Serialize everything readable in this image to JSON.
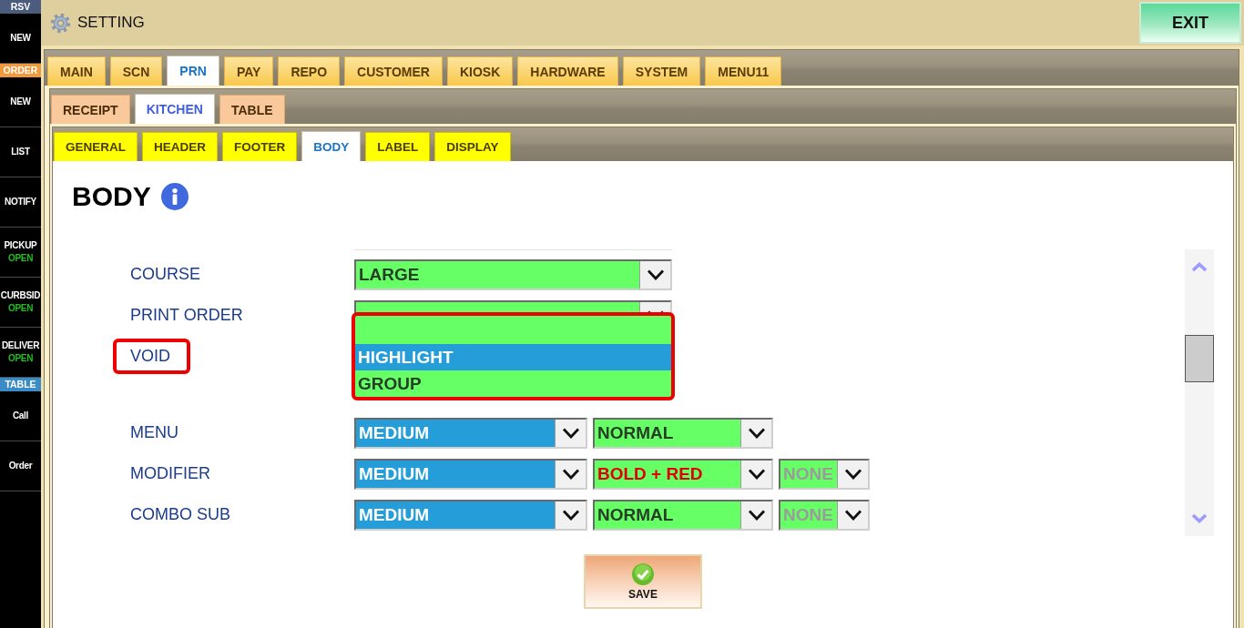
{
  "sidebar": {
    "sections": [
      {
        "title": "RSV",
        "color": "#4c5c7e",
        "items": [
          {
            "label": "NEW"
          }
        ]
      },
      {
        "title": "ORDER",
        "color": "#f2993b",
        "items": [
          {
            "label": "NEW"
          },
          {
            "label": "LIST"
          },
          {
            "label": "NOTIFY"
          },
          {
            "label": "PICKUP",
            "status": "OPEN"
          },
          {
            "label": "CURBSID",
            "status": "OPEN"
          },
          {
            "label": "DELIVER",
            "status": "OPEN"
          }
        ]
      },
      {
        "title": "TABLE",
        "color": "#3a8cc6",
        "items": [
          {
            "label": "Call"
          },
          {
            "label": "Order"
          }
        ]
      }
    ]
  },
  "header": {
    "title": "SETTING",
    "exit_button": "EXIT"
  },
  "tabs": [
    {
      "label": "MAIN",
      "selected": false
    },
    {
      "label": "SCN",
      "selected": false
    },
    {
      "label": "PRN",
      "selected": true
    },
    {
      "label": "PAY",
      "selected": false
    },
    {
      "label": "REPO",
      "selected": false
    },
    {
      "label": "CUSTOMER",
      "selected": false
    },
    {
      "label": "KIOSK",
      "selected": false
    },
    {
      "label": "HARDWARE",
      "selected": false
    },
    {
      "label": "SYSTEM",
      "selected": false
    },
    {
      "label": "MENU11",
      "selected": false
    }
  ],
  "sub_tabs": [
    {
      "label": "RECEIPT",
      "selected": false
    },
    {
      "label": "KITCHEN",
      "selected": true
    },
    {
      "label": "TABLE",
      "selected": false
    }
  ],
  "section_tabs": [
    {
      "label": "GENERAL",
      "selected": false
    },
    {
      "label": "HEADER",
      "selected": false
    },
    {
      "label": "FOOTER",
      "selected": false
    },
    {
      "label": "BODY",
      "selected": true
    },
    {
      "label": "LABEL",
      "selected": false
    },
    {
      "label": "DISPLAY",
      "selected": false
    }
  ],
  "page": {
    "title": "BODY",
    "rows": [
      {
        "label": "COURSE",
        "highlighted": false,
        "dropdowns": [
          {
            "value": "LARGE",
            "color": "#66ff66",
            "alert": false,
            "disabled": false
          }
        ]
      },
      {
        "label": "PRINT ORDER",
        "highlighted": false,
        "dropdowns": [
          {
            "color": "#66ff66"
          }
        ]
      },
      {
        "label": "VOID",
        "highlighted": true,
        "list": {
          "color": "#66ff66",
          "highlighted": true,
          "options": [
            {
              "label": "HIGHLIGHT",
              "selected": true
            },
            {
              "label": "GROUP",
              "selected": false
            }
          ]
        }
      },
      {
        "label": "MENU",
        "highlighted": false,
        "dropdowns": [
          {
            "value": "MEDIUM",
            "color": "#259dd9",
            "alert": false,
            "disabled": false
          },
          {
            "value": "NORMAL",
            "color": "#66ff66",
            "alert": false,
            "disabled": false
          }
        ]
      },
      {
        "label": "MODIFIER",
        "highlighted": false,
        "dropdowns": [
          {
            "value": "MEDIUM",
            "color": "#259dd9",
            "alert": false,
            "disabled": false
          },
          {
            "value": "BOLD + RED",
            "color": "#66ff66",
            "alert": true,
            "disabled": false
          },
          {
            "value": "NONE",
            "color": "#66ff66",
            "alert": false,
            "disabled": true
          }
        ]
      },
      {
        "label": "COMBO SUB",
        "highlighted": false,
        "dropdowns": [
          {
            "value": "MEDIUM",
            "color": "#259dd9",
            "alert": false,
            "disabled": false
          },
          {
            "value": "NORMAL",
            "color": "#66ff66",
            "alert": false,
            "disabled": false
          },
          {
            "value": "NONE",
            "color": "#66ff66",
            "alert": false,
            "disabled": true
          }
        ]
      }
    ],
    "save_button": "SAVE"
  }
}
